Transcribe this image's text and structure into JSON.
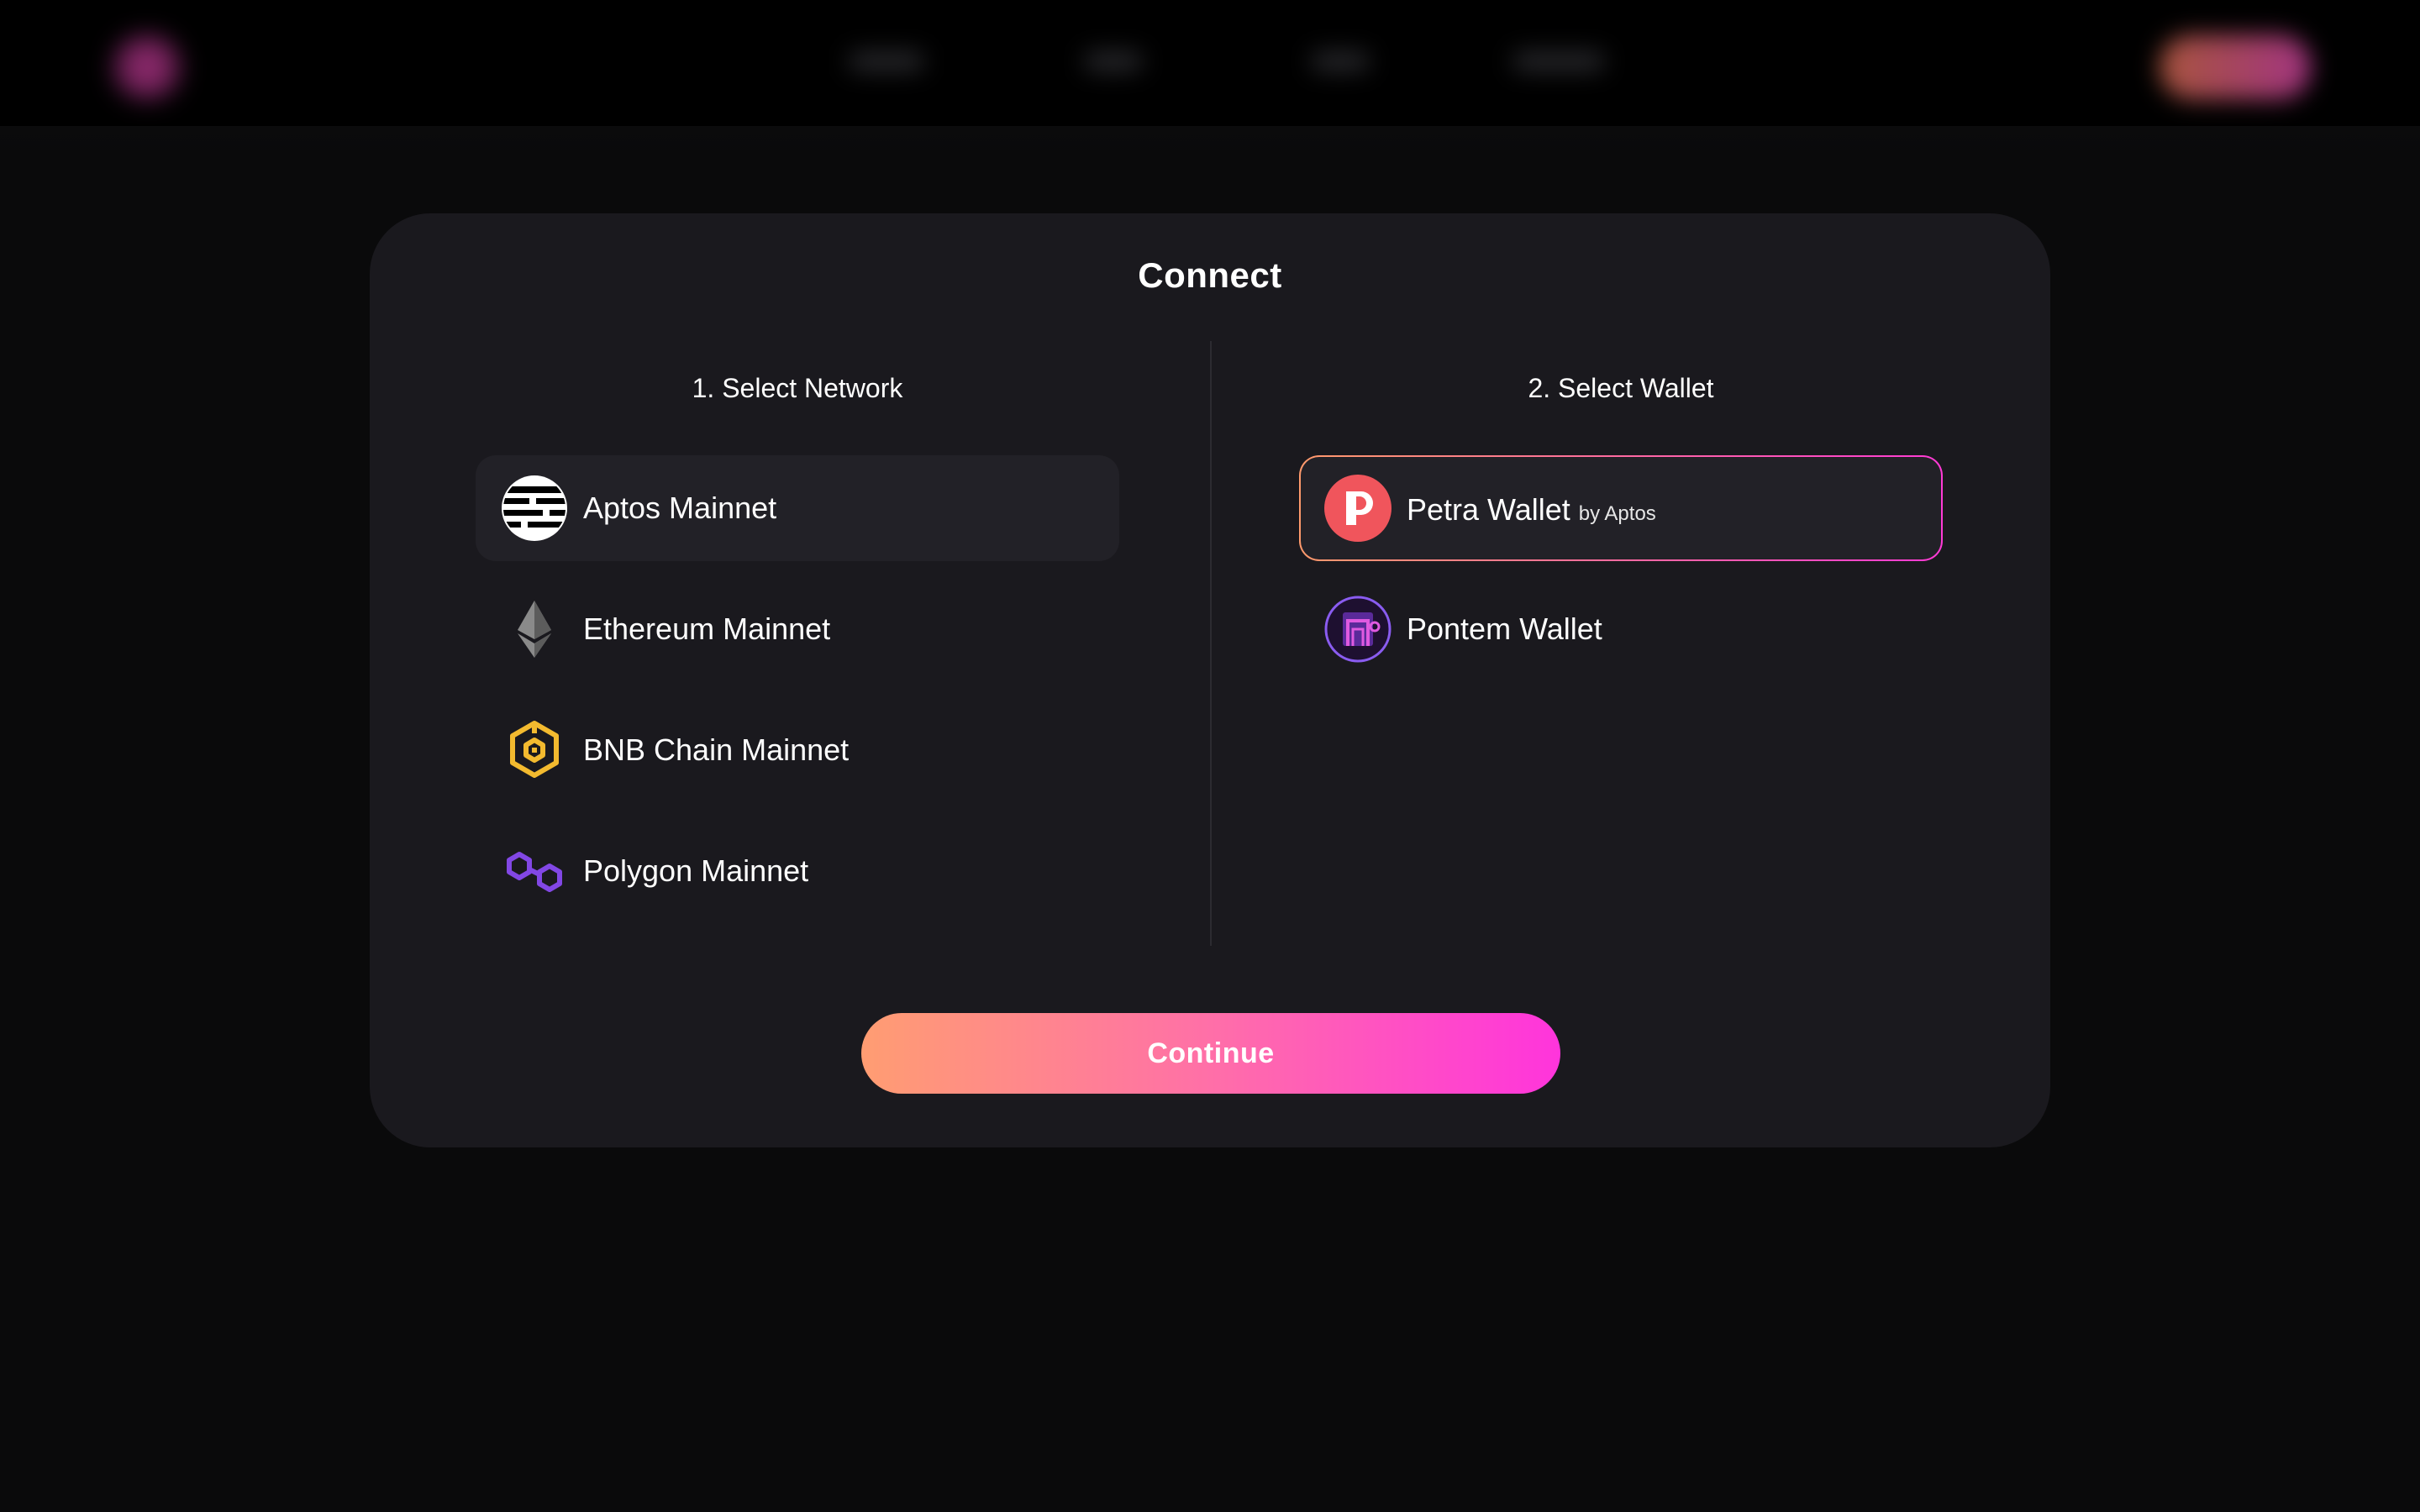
{
  "modal": {
    "title": "Connect",
    "network_heading": "1. Select Network",
    "wallet_heading": "2. Select Wallet",
    "continue_label": "Continue"
  },
  "networks": [
    {
      "label": "Aptos Mainnet",
      "icon": "aptos-icon",
      "selected": true
    },
    {
      "label": "Ethereum Mainnet",
      "icon": "ethereum-icon",
      "selected": false
    },
    {
      "label": "BNB Chain Mainnet",
      "icon": "bnb-icon",
      "selected": false
    },
    {
      "label": "Polygon Mainnet",
      "icon": "polygon-icon",
      "selected": false
    }
  ],
  "wallets": [
    {
      "label": "Petra Wallet",
      "sublabel": "by Aptos",
      "icon": "petra-icon",
      "selected": true
    },
    {
      "label": "Pontem Wallet",
      "icon": "pontem-icon",
      "selected": false
    }
  ],
  "colors": {
    "modal_bg": "#1a191e",
    "page_bg": "#0a0a0b",
    "accent_start": "#ff9d72",
    "accent_end": "#ff34dc",
    "petra_red": "#f0555c",
    "bnb_yellow": "#f3ba2f",
    "polygon_purple": "#8247e5"
  }
}
